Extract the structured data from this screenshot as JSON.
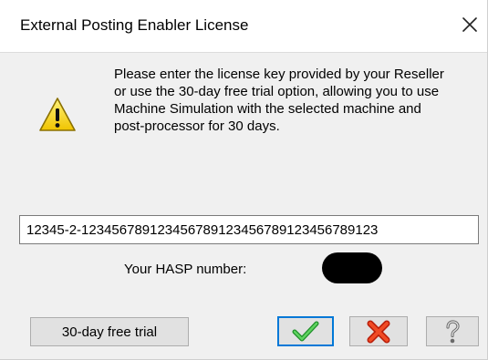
{
  "window": {
    "title": "External Posting Enabler License",
    "close_icon": "close-icon"
  },
  "message": {
    "icon": "warning-icon",
    "text": "Please enter the license key provided by your Reseller\nor use the 30-day free trial option, allowing you to use\nMachine Simulation with the selected machine and\npost-processor for 30 days."
  },
  "license": {
    "key_value": "12345-2-123456789123456789123456789123456789123"
  },
  "hasp": {
    "label": "Your HASP number:",
    "value_redacted": true
  },
  "buttons": {
    "trial_label": "30-day free trial",
    "ok_icon": "checkmark-icon",
    "cancel_icon": "red-x-icon",
    "help_icon": "question-mark-icon"
  },
  "colors": {
    "title_bar": "#ffffff",
    "dialog_bg": "#f0f0f0",
    "ok_check": "#2fa52f",
    "cancel_x": "#e53a1a",
    "focus_border": "#0078d7"
  }
}
